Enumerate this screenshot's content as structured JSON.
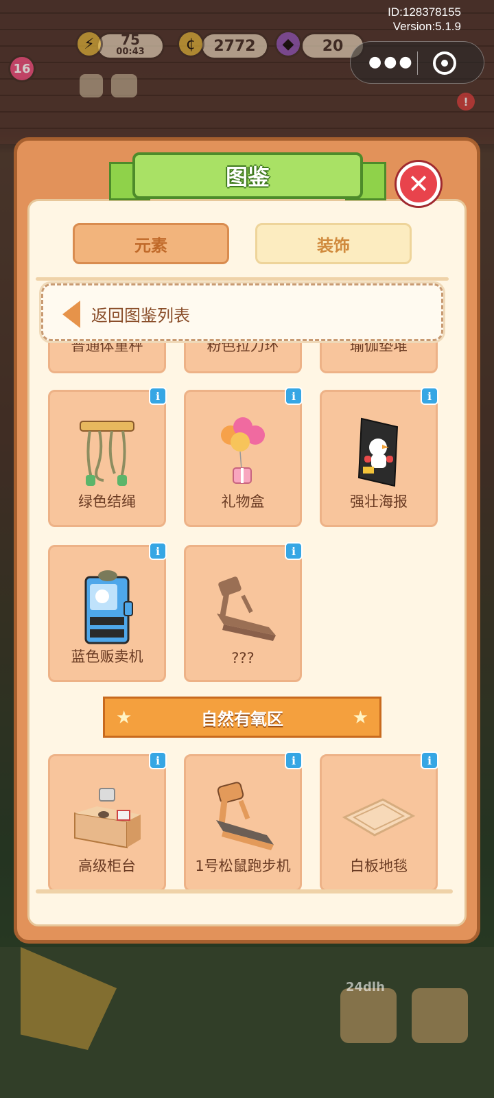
{
  "hud": {
    "user_id": "ID:128378155",
    "version": "Version:5.1.9",
    "level": "16",
    "energy": "75",
    "energy_timer": "00:43",
    "coins": "2772",
    "gems": "20",
    "bottom_timer": "24dlh"
  },
  "modal": {
    "title": "图鉴",
    "tabs": [
      "元素",
      "装饰"
    ],
    "back_label": "返回图鉴列表",
    "cut_row": [
      "普通体重秤",
      "粉色拉力环",
      "瑜伽垫堆"
    ],
    "items_row1": [
      "绿色结绳",
      "礼物盒",
      "强壮海报"
    ],
    "items_row2": [
      "蓝色贩卖机",
      "???"
    ],
    "section_title": "自然有氧区",
    "items_row3": [
      "高级柜台",
      "1号松鼠跑步机",
      "白板地毯"
    ]
  },
  "colors": {
    "accent_green": "#a9e165",
    "close_red": "#e8434c",
    "card_fill": "#f8c59c",
    "info_blue": "#36a6e4",
    "section_orange": "#f4a03e"
  },
  "icons": {
    "close": "close-icon",
    "back": "back-arrow-icon",
    "info": "info-icon",
    "star": "star-icon"
  }
}
